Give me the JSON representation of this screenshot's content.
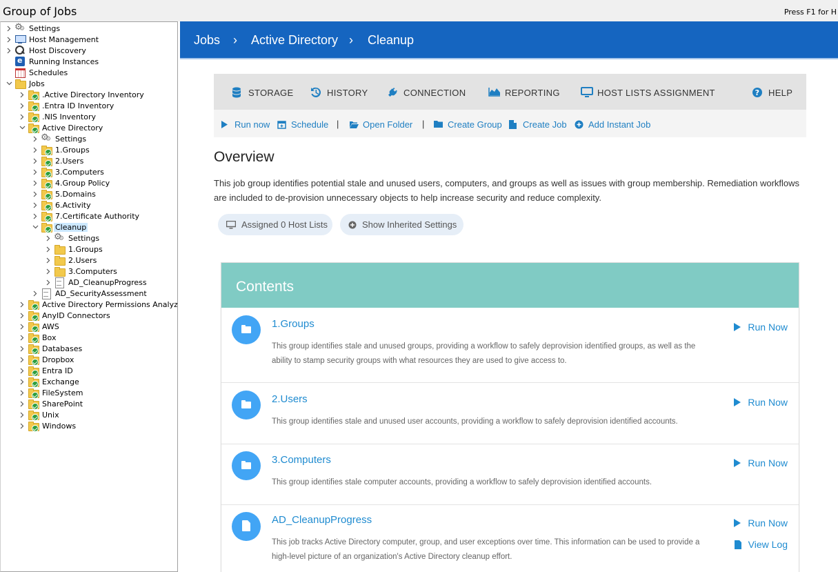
{
  "window": {
    "title": "Group of Jobs",
    "help_hint": "Press F1 for H"
  },
  "tree": [
    {
      "label": "Settings",
      "icon": "gear-icon",
      "depth": 0,
      "chevron": ">"
    },
    {
      "label": "Host Management",
      "icon": "monitor-icon",
      "depth": 0,
      "chevron": ">"
    },
    {
      "label": "Host Discovery",
      "icon": "search-icon",
      "depth": 0,
      "chevron": ">"
    },
    {
      "label": "Running Instances",
      "icon": "running-instances-icon",
      "depth": 0,
      "chevron": ""
    },
    {
      "label": "Schedules",
      "icon": "calendar-icon",
      "depth": 0,
      "chevron": ""
    },
    {
      "label": "Jobs",
      "icon": "folder-icon",
      "depth": 0,
      "chevron": "v"
    },
    {
      "label": ".Active Directory Inventory",
      "icon": "folder-check-icon",
      "depth": 1,
      "chevron": ">"
    },
    {
      "label": ".Entra ID Inventory",
      "icon": "folder-check-icon",
      "depth": 1,
      "chevron": ">"
    },
    {
      "label": ".NIS Inventory",
      "icon": "folder-check-icon",
      "depth": 1,
      "chevron": ">"
    },
    {
      "label": "Active Directory",
      "icon": "folder-check-icon",
      "depth": 1,
      "chevron": "v"
    },
    {
      "label": "Settings",
      "icon": "gear-icon",
      "depth": 2,
      "chevron": ">"
    },
    {
      "label": "1.Groups",
      "icon": "folder-check-icon",
      "depth": 2,
      "chevron": ">"
    },
    {
      "label": "2.Users",
      "icon": "folder-check-icon",
      "depth": 2,
      "chevron": ">"
    },
    {
      "label": "3.Computers",
      "icon": "folder-check-icon",
      "depth": 2,
      "chevron": ">"
    },
    {
      "label": "4.Group Policy",
      "icon": "folder-check-icon",
      "depth": 2,
      "chevron": ">"
    },
    {
      "label": "5.Domains",
      "icon": "folder-check-icon",
      "depth": 2,
      "chevron": ">"
    },
    {
      "label": "6.Activity",
      "icon": "folder-check-icon",
      "depth": 2,
      "chevron": ">"
    },
    {
      "label": "7.Certificate Authority",
      "icon": "folder-check-icon",
      "depth": 2,
      "chevron": ">"
    },
    {
      "label": "Cleanup",
      "icon": "folder-check-icon",
      "depth": 2,
      "chevron": "v",
      "selected": true
    },
    {
      "label": "Settings",
      "icon": "gear-icon",
      "depth": 3,
      "chevron": ">"
    },
    {
      "label": "1.Groups",
      "icon": "folder-icon",
      "depth": 3,
      "chevron": ">"
    },
    {
      "label": "2.Users",
      "icon": "folder-icon",
      "depth": 3,
      "chevron": ">"
    },
    {
      "label": "3.Computers",
      "icon": "folder-icon",
      "depth": 3,
      "chevron": ">"
    },
    {
      "label": "AD_CleanupProgress",
      "icon": "report-file-icon",
      "depth": 3,
      "chevron": ">"
    },
    {
      "label": "AD_SecurityAssessment",
      "icon": "report-file-icon",
      "depth": 2,
      "chevron": ">"
    },
    {
      "label": "Active Directory Permissions Analyzer",
      "icon": "folder-check-icon",
      "depth": 1,
      "chevron": ">"
    },
    {
      "label": "AnyID Connectors",
      "icon": "folder-check-icon",
      "depth": 1,
      "chevron": ">"
    },
    {
      "label": "AWS",
      "icon": "folder-check-icon",
      "depth": 1,
      "chevron": ">"
    },
    {
      "label": "Box",
      "icon": "folder-check-icon",
      "depth": 1,
      "chevron": ">"
    },
    {
      "label": "Databases",
      "icon": "folder-check-icon",
      "depth": 1,
      "chevron": ">"
    },
    {
      "label": "Dropbox",
      "icon": "folder-check-icon",
      "depth": 1,
      "chevron": ">"
    },
    {
      "label": "Entra ID",
      "icon": "folder-check-icon",
      "depth": 1,
      "chevron": ">"
    },
    {
      "label": "Exchange",
      "icon": "folder-check-icon",
      "depth": 1,
      "chevron": ">"
    },
    {
      "label": "FileSystem",
      "icon": "folder-check-icon",
      "depth": 1,
      "chevron": ">"
    },
    {
      "label": "SharePoint",
      "icon": "folder-check-icon",
      "depth": 1,
      "chevron": ">"
    },
    {
      "label": "Unix",
      "icon": "folder-check-icon",
      "depth": 1,
      "chevron": ">"
    },
    {
      "label": "Windows",
      "icon": "folder-check-icon",
      "depth": 1,
      "chevron": ">"
    }
  ],
  "breadcrumb": {
    "items": [
      "Jobs",
      "Active Directory",
      "Cleanup"
    ],
    "separator": "›"
  },
  "toolbar": {
    "storage": "STORAGE",
    "history": "HISTORY",
    "connection": "CONNECTION",
    "reporting": "REPORTING",
    "host_lists": "HOST LISTS ASSIGNMENT",
    "help": "HELP"
  },
  "actions": {
    "run_now": "Run now",
    "schedule": "Schedule",
    "open_folder": "Open Folder",
    "create_group": "Create Group",
    "create_job": "Create Job",
    "add_instant_job": "Add Instant Job",
    "separator": "|"
  },
  "overview": {
    "title": "Overview",
    "text": "This job group identifies potential stale and unused users, computers, and groups as well as issues with group membership. Remediation workflows are included to de-provision unnecessary objects to help increase security and reduce complexity."
  },
  "pills": {
    "assigned": "Assigned 0 Host Lists",
    "inherited": "Show Inherited Settings"
  },
  "contents": {
    "title": "Contents",
    "run_label": "Run Now",
    "log_label": "View Log",
    "items": [
      {
        "title": "1.Groups",
        "icon": "folder-icon",
        "desc": "This group identifies stale and unused groups, providing a workflow to safely deprovision identified groups, as well as the ability to stamp security groups with what resources they are used to give access to."
      },
      {
        "title": "2.Users",
        "icon": "folder-icon",
        "desc": "This group identifies stale and unused user accounts, providing a workflow to safely deprovision identified accounts."
      },
      {
        "title": "3.Computers",
        "icon": "folder-icon",
        "desc": "This group identifies stale computer accounts, providing a workflow to safely deprovision identified accounts."
      },
      {
        "title": "AD_CleanupProgress",
        "icon": "document-icon",
        "desc": "This job tracks Active Directory computer, group, and user exceptions over time. This information can be used to provide a high-level picture of an organization's Active Directory cleanup effort."
      }
    ]
  },
  "colors": {
    "header_blue": "#1565c0",
    "contents_teal": "#80cbc4",
    "link_blue": "#1f8bd0",
    "icon_blue": "#42a5f5"
  }
}
